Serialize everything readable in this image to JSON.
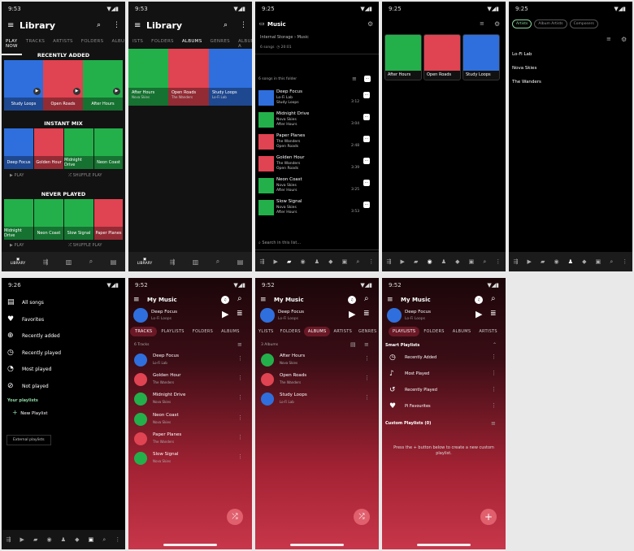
{
  "status": {
    "t1": "9:53",
    "t2": "9:53",
    "t3": "9:25",
    "t4": "9:25",
    "t5": "9:25",
    "t6": "9:26",
    "t7": "9:52",
    "t8": "9:52",
    "t9": "9:52"
  },
  "s1": {
    "title": "Library",
    "tabs": [
      "PLAY NOW",
      "TRACKS",
      "ARTISTS",
      "FOLDERS",
      "ALBU"
    ],
    "recent_heading": "RECENTLY ADDED",
    "recent": [
      "Study Loops",
      "Open Roads",
      "After Hours"
    ],
    "instant_heading": "INSTANT MIX",
    "instant": [
      "Deep Focus",
      "Golden Hour",
      "Midnight Drive",
      "Neon Coast"
    ],
    "play": "PLAY",
    "shuffle": "SHUFFLE PLAY",
    "never_heading": "NEVER PLAYED",
    "never": [
      "Midnight Drive",
      "Neon Coast",
      "Slow Signal",
      "Paper Planes"
    ],
    "nav_label": "LIBRARY"
  },
  "s2": {
    "title": "Library",
    "tabs": [
      "ISTS",
      "FOLDERS",
      "ALBUMS",
      "GENRES",
      "ALBUM A"
    ],
    "albums": [
      {
        "name": "After Hours",
        "artist": "Nova Skies"
      },
      {
        "name": "Open Roads",
        "artist": "The Wanders"
      },
      {
        "name": "Study Loops",
        "artist": "Lo-Fi Lab"
      }
    ],
    "nav_label": "LIBRARY"
  },
  "s3": {
    "title": "Music",
    "path": "Internal Storage › Music",
    "songs_count": "6 songs",
    "duration": "20:01",
    "folder_label": "6 songs in this folder",
    "songs": [
      {
        "t": "Deep Focus",
        "a": "Lo-Fi Lab",
        "al": "Study Loops",
        "d": "3:12"
      },
      {
        "t": "Midnight Drive",
        "a": "Nova Skies",
        "al": "After Hours",
        "d": "3:04"
      },
      {
        "t": "Paper Planes",
        "a": "The Wanders",
        "al": "Open Roads",
        "d": "2:48"
      },
      {
        "t": "Golden Hour",
        "a": "The Wanders",
        "al": "Open Roads",
        "d": "3:39"
      },
      {
        "t": "Neon Coast",
        "a": "Nova Skies",
        "al": "After Hours",
        "d": "3:25"
      },
      {
        "t": "Slow Signal",
        "a": "Nova Skies",
        "al": "After Hours",
        "d": "3:53"
      }
    ],
    "search_placeholder": "Search in this list..."
  },
  "s4": {
    "albums": [
      "After Hours",
      "Open Roads",
      "Study Loops"
    ]
  },
  "s5": {
    "chips": [
      "Artists",
      "Album Artists",
      "Composers"
    ],
    "artists": [
      "Lo-Fi Lab",
      "Nova Skies",
      "The Wanders"
    ]
  },
  "s6": {
    "items": [
      "All songs",
      "Favorites",
      "Recently added",
      "Recently played",
      "Most played",
      "Not played"
    ],
    "your_playlists": "Your playlists",
    "new_playlist": "New Playlist",
    "external": "External playlists"
  },
  "s7": {
    "title": "My Music",
    "np_title": "Deep Focus",
    "np_artist": "Lo-Fi Loops",
    "tabs": [
      "TRACKS",
      "PLAYLISTS",
      "FOLDERS",
      "ALBUMS"
    ],
    "count": "6 Tracks",
    "tracks": [
      {
        "t": "Deep Focus",
        "a": "Lo-Fi Lab"
      },
      {
        "t": "Golden Hour",
        "a": "The Wanders"
      },
      {
        "t": "Midnight Drive",
        "a": "Nova Skies"
      },
      {
        "t": "Neon Coast",
        "a": "Nova Skies"
      },
      {
        "t": "Paper Planes",
        "a": "The Wanders"
      },
      {
        "t": "Slow Signal",
        "a": "Nova Skies"
      }
    ]
  },
  "s8": {
    "title": "My Music",
    "np_title": "Deep Focus",
    "np_artist": "Lo-Fi Loops",
    "tabs": [
      "YLISTS",
      "FOLDERS",
      "ALBUMS",
      "ARTISTS",
      "GENRES"
    ],
    "count": "3 Albums",
    "albums": [
      {
        "t": "After Hours",
        "a": "Nova Skies"
      },
      {
        "t": "Open Roads",
        "a": "The Wanders"
      },
      {
        "t": "Study Loops",
        "a": "Lo-Fi Lab"
      }
    ]
  },
  "s9": {
    "title": "My Music",
    "np_title": "Deep Focus",
    "np_artist": "Lo-Fi Loops",
    "tabs": [
      "PLAYLISTS",
      "FOLDERS",
      "ALBUMS",
      "ARTISTS"
    ],
    "smart": "Smart Playlists",
    "smart_items": [
      "Recently Added",
      "Most Played",
      "Recently Played",
      "Pi Favourites"
    ],
    "custom": "Custom Playlists (0)",
    "empty": "Press the + button below to create a new custom playlist."
  },
  "colors": {
    "red": "#e04351",
    "green": "#23b04b",
    "blue": "#2f6fdd",
    "accent": "#8bd6a0"
  }
}
